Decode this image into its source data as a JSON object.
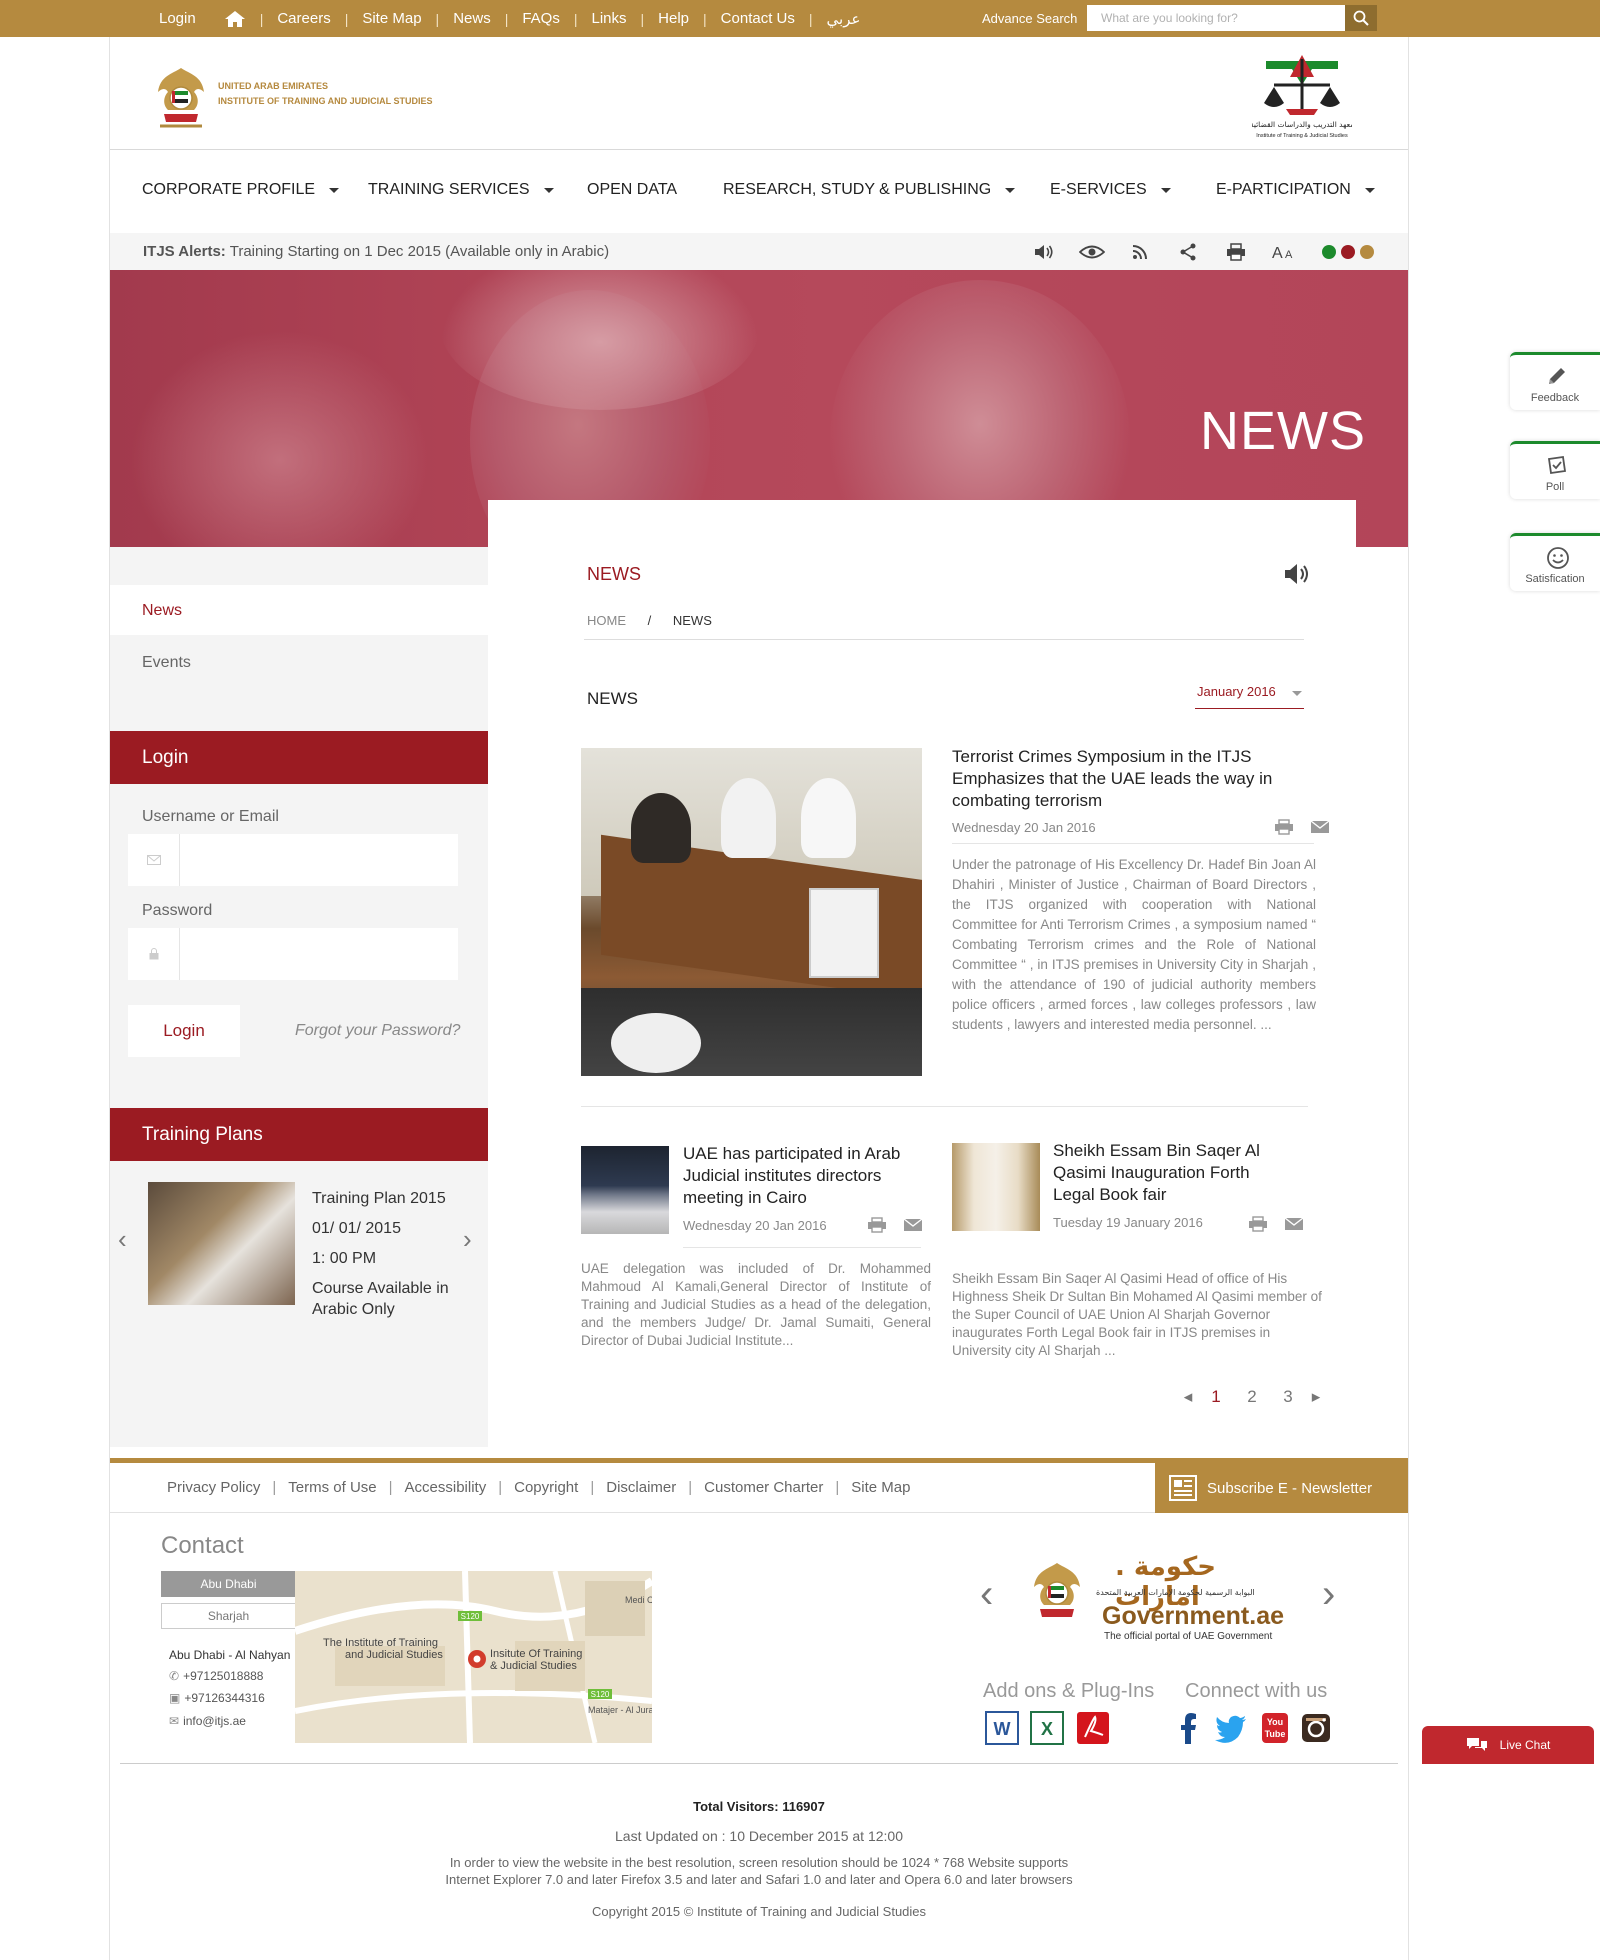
{
  "topbar": {
    "links": [
      "Login",
      "Careers",
      "Site Map",
      "News",
      "FAQs",
      "Links",
      "Help",
      "Contact Us",
      "عربي"
    ],
    "advance_search": "Advance Search",
    "search_placeholder": "What are you looking for?"
  },
  "brand": {
    "line1": "UNITED ARAB EMIRATES",
    "line2": "INSTITUTE OF TRAINING AND JUDICIAL STUDIES"
  },
  "nav": [
    "CORPORATE PROFILE",
    "TRAINING SERVICES",
    "OPEN DATA",
    "RESEARCH, STUDY & PUBLISHING",
    "E-SERVICES",
    "E-PARTICIPATION"
  ],
  "alerts": {
    "label": "ITJS Alerts:",
    "text": "Training Starting on 1 Dec 2015 (Available only in Arabic)"
  },
  "theme_colors": [
    "#1c8a2c",
    "#9b1b22",
    "#b58a3f"
  ],
  "banner": {
    "title": "NEWS"
  },
  "sidebar": {
    "items": [
      "News",
      "Events"
    ],
    "login": {
      "title": "Login",
      "username_label": "Username or Email",
      "password_label": "Password",
      "button": "Login",
      "forgot": "Forgot your Password?"
    },
    "training": {
      "title": "Training Plans",
      "name": "Training Plan 2015",
      "date": "01/ 01/ 2015",
      "time": "1: 00 PM",
      "note": "Course Available in Arabic Only"
    }
  },
  "main": {
    "title": "NEWS",
    "breadcrumb": [
      "HOME",
      "/",
      "NEWS"
    ],
    "section": "NEWS",
    "month_filter": "January 2016",
    "articles": [
      {
        "title": "Terrorist Crimes Symposium in the ITJS Emphasizes that the UAE leads the way in combating terrorism",
        "date": "Wednesday 20 Jan 2016",
        "summary": "Under the patronage of  His Excellency Dr. Hadef  Bin Joan Al Dhahiri , Minister of Justice , Chairman of  Board Directors  , the ITJS organized with cooperation with National Committee for Anti Terrorism Crimes , a symposium named “ Combating Terrorism crimes and the Role of National Committee “ , in ITJS premises in University City in Sharjah  , with the attendance of 190 of judicial authority members police officers  , armed forces  , law colleges professors , law students , lawyers and interested media personnel. ..."
      },
      {
        "title": "UAE has participated in Arab Judicial institutes  directors meeting in Cairo",
        "date": "Wednesday 20 Jan 2016",
        "summary": "UAE delegation was included of  Dr. Mohammed Mahmoud Al Kamali,General Director of Institute of Training and Judicial Studies as a head of the delegation, and the members Judge/ Dr. Jamal Sumaiti, General Director of Dubai Judicial Institute..."
      },
      {
        "title": "Sheikh Essam Bin Saqer Al Qasimi Inauguration Forth Legal Book fair",
        "date": "Tuesday 19 January 2016",
        "summary": "Sheikh Essam Bin Saqer Al Qasimi Head of office of His Highness Sheik Dr Sultan Bin Mohamed Al Qasimi member of the Super Council of UAE Union Al Sharjah Governor inaugurates Forth Legal Book fair in ITJS premises in University city Al Sharjah ..."
      }
    ],
    "pages": [
      "1",
      "2",
      "3"
    ]
  },
  "floating": [
    "Feedback",
    "Poll",
    "Satisfication"
  ],
  "footer": {
    "links": [
      "Privacy Policy",
      "Terms of Use",
      "Accessibility",
      "Copyright",
      "Disclaimer",
      "Customer Charter",
      "Site Map"
    ],
    "subscribe": "Subscribe E - Newsletter",
    "contact_title": "Contact",
    "cities": [
      "Abu Dhabi",
      "Sharjah"
    ],
    "address_title": "Abu Dhabi - Al Nahyan",
    "phone": "+97125018888",
    "fax": "+97126344316",
    "email": "info@itjs.ae",
    "map_labels": {
      "inst_en": "The Institute of Training and Judicial Studies",
      "inst_alt": "Insitute Of Training & Judicial Studies",
      "road1": "S120",
      "road2": "S120",
      "area": "Matajer - Al Juraina",
      "college": "Medi Colle"
    },
    "gov": {
      "ar": "حكومة . امارات",
      "sub_ar": "البوابة الرسمية لحكومة الإمارات العربية المتحدة",
      "en": "Government.ae",
      "tag": "The official portal of UAE Government"
    },
    "addons_title": "Add ons & Plug-Ins",
    "connect_title": "Connect with us",
    "visitors": "Total Visitors: 116907",
    "updated": "Last Updated on : 10 December 2015 at 12:00",
    "resolution": "In order to view the website in the best resolution, screen resolution should be 1024 * 768 Website supports Internet Explorer 7.0 and later Firefox 3.5 and later and Safari 1.0 and later and Opera 6.0 and later browsers",
    "copyright": "Copyright 2015 © Institute of Training and Judicial Studies",
    "live_chat": "Live Chat"
  }
}
